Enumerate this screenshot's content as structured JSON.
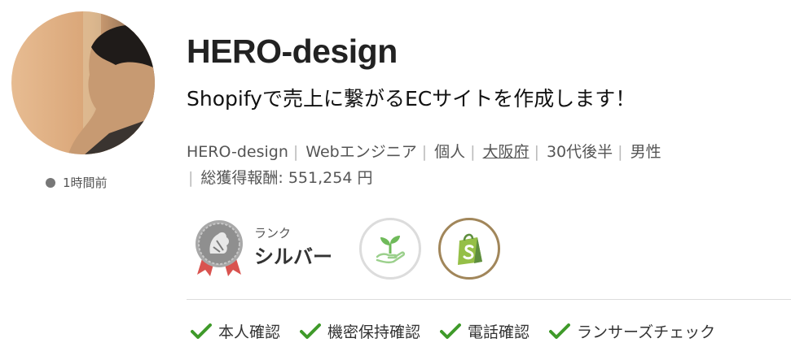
{
  "profile": {
    "name": "HERO-design",
    "catchphrase": "Shopifyで売上に繋がるECサイトを作成します！",
    "last_login": "1時間前"
  },
  "meta": {
    "username": "HERO-design",
    "occupation": "Webエンジニア",
    "type": "個人",
    "prefecture": "大阪府",
    "age": "30代後半",
    "gender": "男性",
    "earnings": "総獲得報酬: 551,254 円"
  },
  "rank": {
    "label": "ランク",
    "value": "シルバー"
  },
  "badges": [
    {
      "icon": "seedling-icon",
      "color": "#6fba5a"
    },
    {
      "icon": "shopify-icon",
      "color": "#5e8e3e"
    }
  ],
  "verifications": [
    {
      "label": "本人確認"
    },
    {
      "label": "機密保持確認"
    },
    {
      "label": "電話確認"
    },
    {
      "label": "ランサーズチェック"
    }
  ],
  "colors": {
    "check": "#3f9a2a",
    "shopify_ring": "#a1865a"
  }
}
